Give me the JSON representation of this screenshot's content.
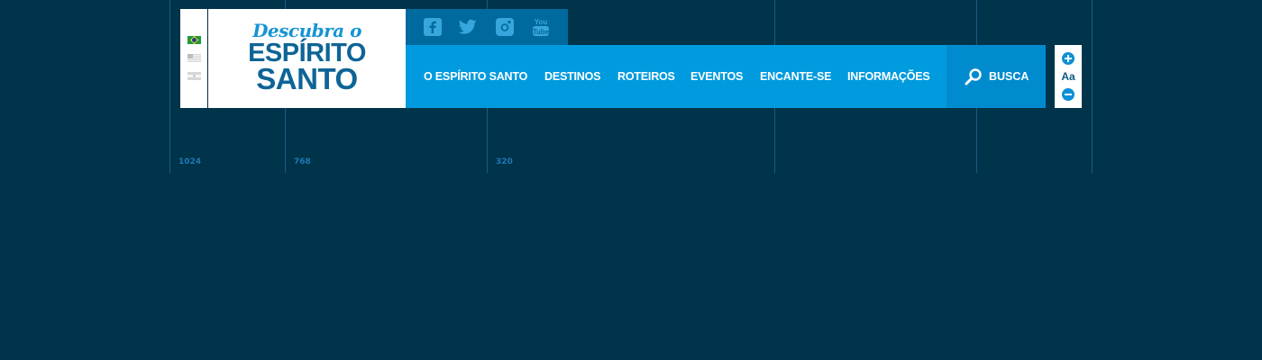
{
  "breakpoints": [
    {
      "label": "1024"
    },
    {
      "label": "768"
    },
    {
      "label": "320"
    }
  ],
  "languages": [
    {
      "name": "brazil-flag-icon"
    },
    {
      "name": "usa-flag-icon"
    },
    {
      "name": "argentina-flag-icon"
    }
  ],
  "logo": {
    "script": "Descubra o",
    "line1": "ESPÍRITO",
    "line2": "SANTO"
  },
  "social": [
    {
      "name": "facebook-icon"
    },
    {
      "name": "twitter-icon"
    },
    {
      "name": "instagram-icon"
    },
    {
      "name": "youtube-icon"
    }
  ],
  "nav": {
    "items": [
      {
        "label": "O ESPÍRITO SANTO"
      },
      {
        "label": "DESTINOS"
      },
      {
        "label": "ROTEIROS"
      },
      {
        "label": "EVENTOS"
      },
      {
        "label": "ENCANTE-SE"
      },
      {
        "label": "INFORMAÇÕES"
      }
    ]
  },
  "search": {
    "label": "BUSCA"
  },
  "accessibility": {
    "font_label": "Aa"
  },
  "colors": {
    "background": "#00344a",
    "nav": "#009bde",
    "social_bar": "#006a9f",
    "search": "#008bcf",
    "logo_blue": "#0e6496"
  }
}
